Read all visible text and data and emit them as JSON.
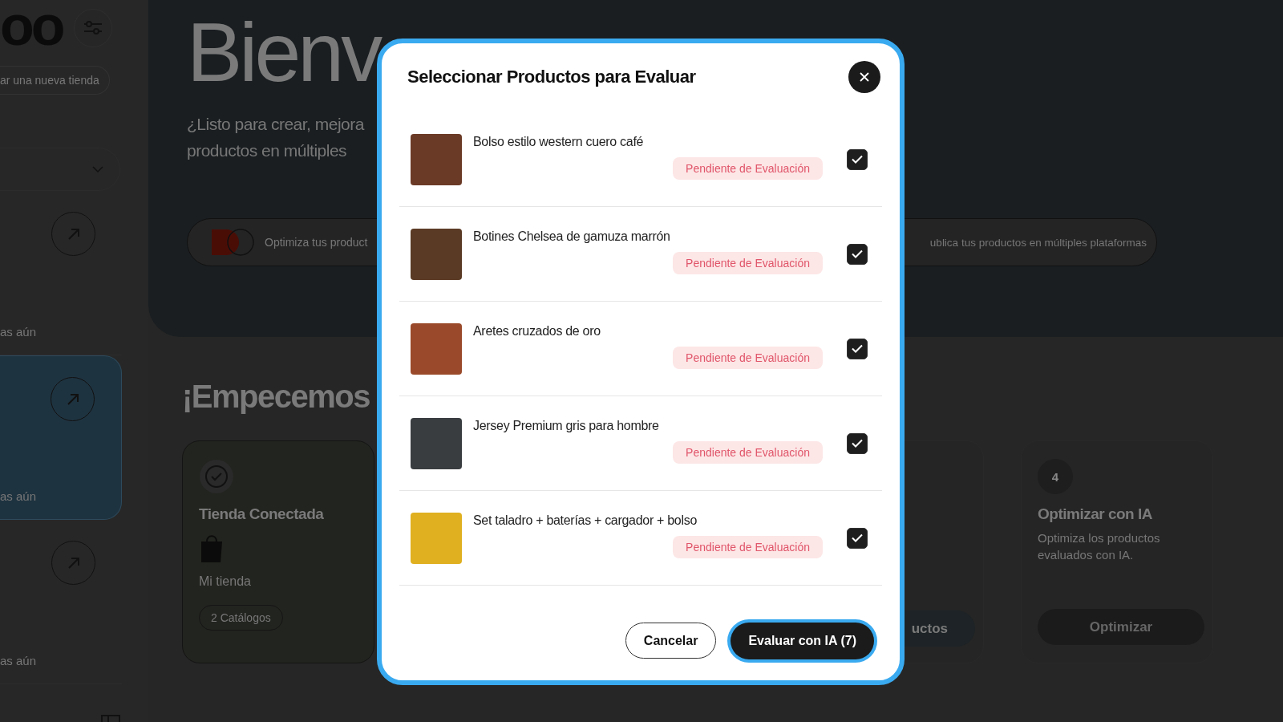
{
  "sidebar": {
    "logo": "oo",
    "new_store": "ar una nueva tienda",
    "items": [
      {
        "label": "as aún",
        "selected": false
      },
      {
        "label": "as aún",
        "selected": true
      },
      {
        "label": "as aún",
        "selected": false
      }
    ]
  },
  "hero": {
    "title": "Bienv",
    "subtitle": [
      "¿Listo para crear, mejora",
      "productos en múltiples"
    ],
    "pill_left": "Optimiza tus product",
    "pill_right": "ublica tus productos en múltiples plataformas"
  },
  "getting_started": {
    "title": "¡Empecemos",
    "cards": [
      {
        "kind": "done",
        "title": "Tienda Conectada",
        "store": "Mi tienda",
        "tag": "2 Catálogos"
      },
      {
        "kind": "partial",
        "button": "uctos"
      },
      {
        "kind": "step",
        "step": "4",
        "title": "Optimizar con IA",
        "text": "Optimiza los productos evaluados con IA.",
        "button": "Optimizar",
        "disabled": true
      }
    ]
  },
  "modal": {
    "title": "Seleccionar Productos para Evaluar",
    "products": [
      {
        "name": "Bolso estilo western cuero café",
        "status": "Pendiente de Evaluación",
        "checked": true,
        "color": "#6b3a26"
      },
      {
        "name": "Botines Chelsea de gamuza marrón",
        "status": "Pendiente de Evaluación",
        "checked": true,
        "color": "#5a3a24"
      },
      {
        "name": "Aretes cruzados de oro",
        "status": "Pendiente de Evaluación",
        "checked": true,
        "color": "#9a4a2a"
      },
      {
        "name": "Jersey Premium gris para hombre",
        "status": "Pendiente de Evaluación",
        "checked": true,
        "color": "#3a3d40"
      },
      {
        "name": "Set taladro + baterías + cargador + bolso",
        "status": "Pendiente de Evaluación",
        "checked": true,
        "color": "#e0b020"
      }
    ],
    "cancel": "Cancelar",
    "submit": "Evaluar con IA (7)"
  }
}
